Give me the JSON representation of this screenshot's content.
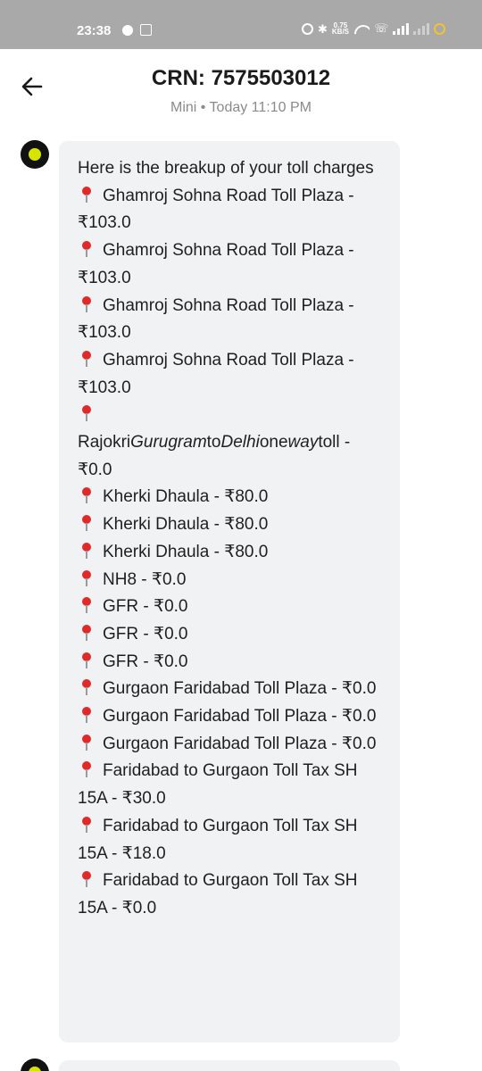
{
  "status_bar": {
    "time": "23:38",
    "speed_value": "0.75",
    "speed_unit": "KB/S"
  },
  "header": {
    "title": "CRN: 7575503012",
    "subtitle": "Mini • Today 11:10 PM"
  },
  "message": {
    "intro": "Here is the breakup of your toll charges",
    "items": [
      "Ghamroj Sohna Road Toll Plaza - ₹103.0",
      "Ghamroj Sohna Road Toll Plaza - ₹103.0",
      "Ghamroj Sohna Road Toll Plaza - ₹103.0",
      "Ghamroj Sohna Road Toll Plaza - ₹103.0",
      "Kherki Dhaula - ₹80.0",
      "Kherki Dhaula - ₹80.0",
      "Kherki Dhaula - ₹80.0",
      "NH8 - ₹0.0",
      "GFR - ₹0.0",
      "GFR - ₹0.0",
      "GFR - ₹0.0",
      "Gurgaon Faridabad Toll Plaza - ₹0.0",
      "Gurgaon Faridabad Toll Plaza - ₹0.0",
      "Gurgaon Faridabad Toll Plaza - ₹0.0",
      "Faridabad to Gurgaon Toll Tax SH 15A - ₹30.0",
      "Faridabad to Gurgaon Toll Tax SH 15A - ₹18.0",
      "Faridabad to Gurgaon Toll Tax SH 15A - ₹0.0"
    ],
    "rajokri": {
      "p1": "Rajokri",
      "p2": "Gurugram",
      "p3": "to",
      "p4": "Delhi",
      "p5": "one",
      "p6": "way",
      "p7": "toll -",
      "p8": "₹0.0"
    }
  }
}
